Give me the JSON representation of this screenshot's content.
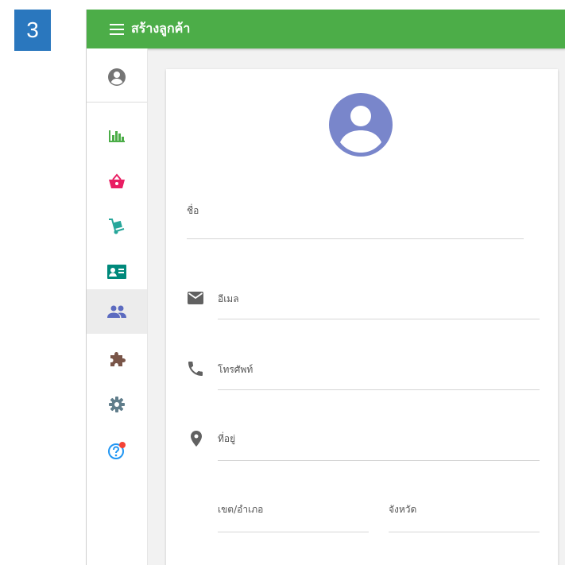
{
  "step_number": "3",
  "appbar": {
    "title": "สร้างลูกค้า",
    "background": "#4cad48"
  },
  "sidebar": {
    "items": [
      {
        "icon": "account-circle-icon",
        "color": "#757575"
      },
      {
        "icon": "bar-chart-icon",
        "color": "#4cad48"
      },
      {
        "icon": "shopping-basket-icon",
        "color": "#e91e63"
      },
      {
        "icon": "dolly-icon",
        "color": "#26a69a"
      },
      {
        "icon": "id-card-icon",
        "color": "#00897b"
      },
      {
        "icon": "people-icon",
        "color": "#5c6bc0",
        "active": true
      },
      {
        "icon": "puzzle-icon",
        "color": "#795548"
      },
      {
        "icon": "gear-icon",
        "color": "#607d8b"
      },
      {
        "icon": "help-icon",
        "color": "#2196f3",
        "badge_color": "#f44336"
      }
    ]
  },
  "form": {
    "avatar_color": "#7986cb",
    "name_label": "ชื่อ",
    "email_label": "อีเมล",
    "phone_label": "โทรศัพท์",
    "address_label": "ที่อยู่",
    "district_label": "เขต/อำเภอ",
    "province_label": "จังหวัด"
  }
}
